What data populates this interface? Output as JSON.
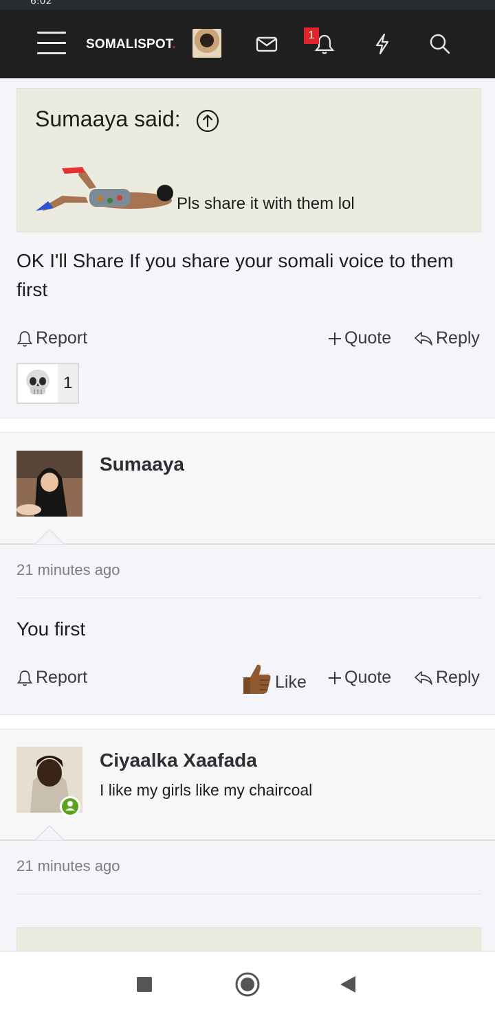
{
  "status_bar": {
    "time": "6:02"
  },
  "header": {
    "logo": "SOMALISPOT",
    "logo_dot": ".",
    "alerts_badge": "1",
    "icons": [
      "menu-icon",
      "user-avatar",
      "mail-icon",
      "bell-icon",
      "bolt-icon",
      "search-icon"
    ]
  },
  "post1": {
    "quote": {
      "author": "Sumaaya said:",
      "text": "Pls share it with them lol"
    },
    "message": "OK I'll Share If you share your somali voice to them first",
    "actions": {
      "report": "Report",
      "quote": "Quote",
      "reply": "Reply"
    },
    "reaction": {
      "emoji": "skull",
      "count": "1"
    }
  },
  "post2": {
    "username": "Sumaaya",
    "time": "21 minutes ago",
    "message": "You first",
    "actions": {
      "report": "Report",
      "like": "Like",
      "quote": "Quote",
      "reply": "Reply"
    }
  },
  "post3": {
    "username": "Ciyaalka Xaafada",
    "user_title": "I like my girls like my chaircoal",
    "time": "21 minutes ago",
    "online": true
  },
  "colors": {
    "header_bg": "#1f1f1f",
    "badge": "#e0242b",
    "quote_bg": "#ecebe0",
    "online": "#5aa51a"
  }
}
